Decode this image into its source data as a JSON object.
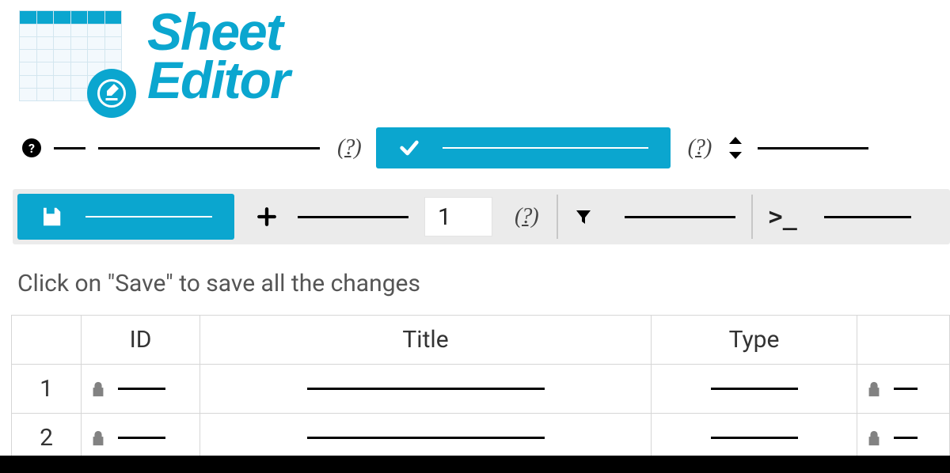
{
  "brand": {
    "line1": "Sheet",
    "line2": "Editor"
  },
  "icons": {
    "question": "?",
    "help_link_text": "( ? )",
    "terminal": ">_"
  },
  "filters": {
    "help_link_1": "( ? )",
    "help_link_2": "( ? )"
  },
  "toolbar": {
    "rows_to_add": "1",
    "help_link": "( ? )"
  },
  "hint": "Click on \"Save\" to save all the changes",
  "sheet": {
    "headers": {
      "rownum": "",
      "id": "ID",
      "title": "Title",
      "type": "Type",
      "extra": ""
    },
    "rows": [
      {
        "num": "1"
      },
      {
        "num": "2"
      }
    ]
  }
}
